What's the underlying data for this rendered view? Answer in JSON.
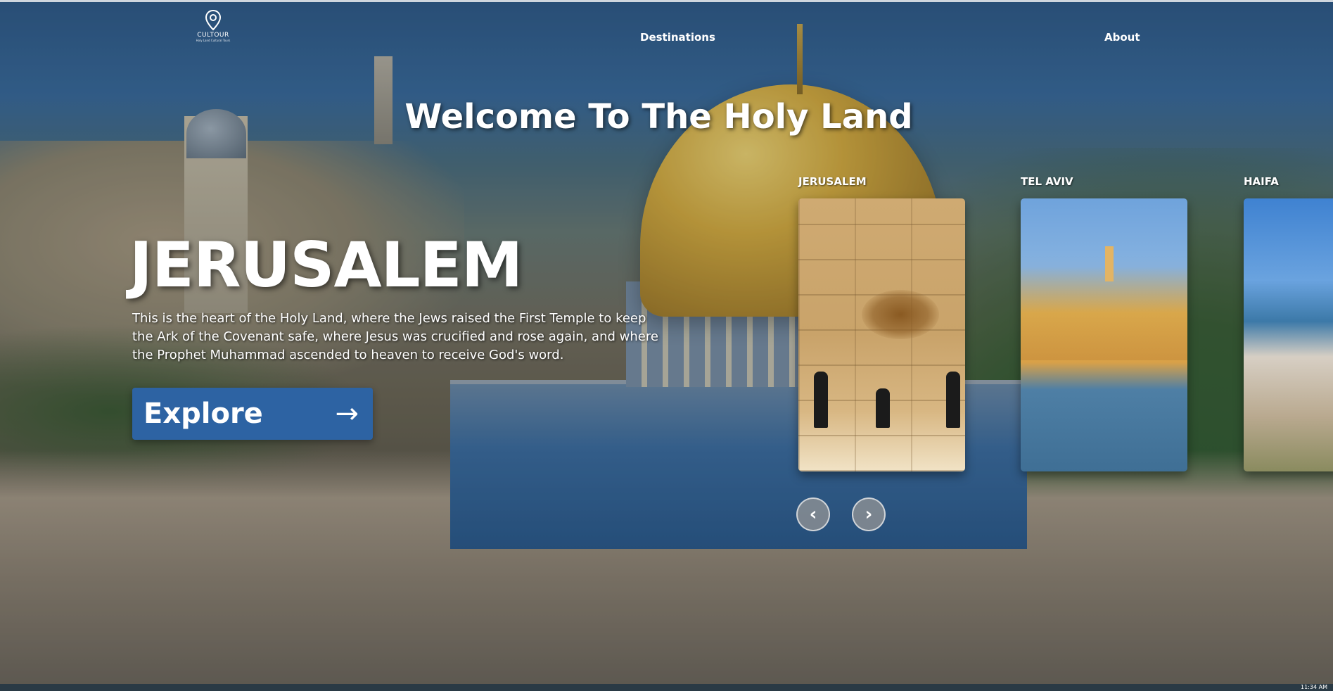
{
  "brand": {
    "name": "CULTOUR",
    "tagline": "Holy Land Cultural Tours",
    "logo_icon": "map-pin-icon"
  },
  "nav": {
    "destinations": "Destinations",
    "about": "About"
  },
  "hero": {
    "welcome": "Welcome To The Holy Land",
    "city": "JERUSALEM",
    "description": "This is the heart of the Holy Land, where the Jews raised the First Temple to keep the Ark of the Covenant safe, where Jesus was crucified and rose again, and where the Prophet Muhammad ascended to heaven to receive God's word.",
    "explore_label": "Explore",
    "explore_arrow": "→"
  },
  "carousel": {
    "cards": [
      {
        "label": "JERUSALEM"
      },
      {
        "label": "TEL AVIV"
      },
      {
        "label": "HAIFA"
      }
    ],
    "prev_icon": "‹",
    "next_icon": "›"
  },
  "taskbar": {
    "clock": "11:34 AM"
  },
  "colors": {
    "accent": "#2d63a3",
    "text": "#ffffff"
  }
}
